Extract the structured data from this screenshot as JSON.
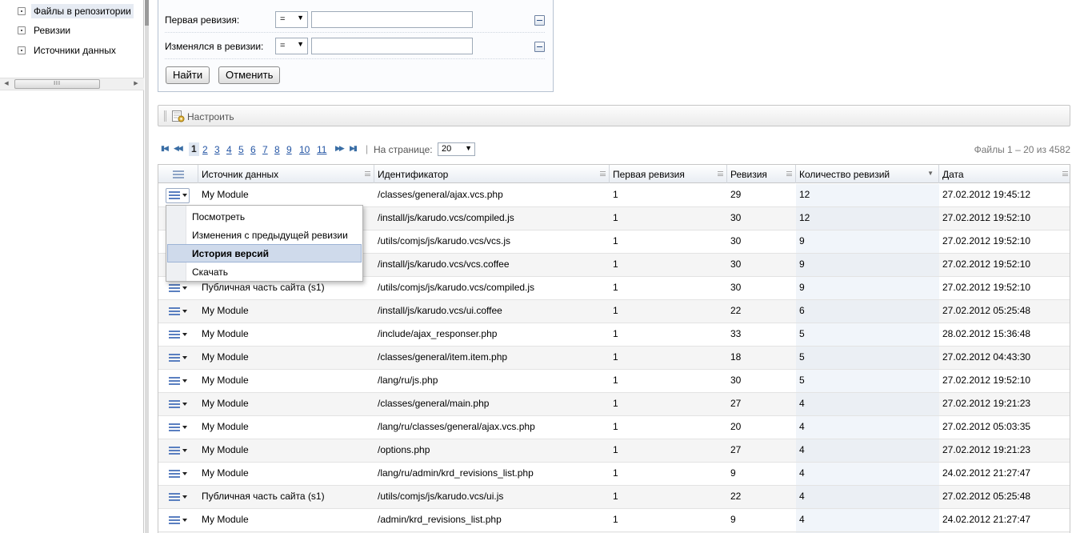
{
  "tree": {
    "items": [
      {
        "label": "Файлы в репозитории",
        "selected": true
      },
      {
        "label": "Ревизии",
        "selected": false
      },
      {
        "label": "Источники данных",
        "selected": false
      }
    ]
  },
  "left_scrollbar": {
    "thumb_glyph": "III"
  },
  "filter": {
    "rows": [
      {
        "label": "Первая ревизия:",
        "operator": "=",
        "value": ""
      },
      {
        "label": "Изменялся в ревизии:",
        "operator": "=",
        "value": ""
      }
    ],
    "find_label": "Найти",
    "cancel_label": "Отменить"
  },
  "toolbar": {
    "settings_label": "Настроить"
  },
  "pager": {
    "pages": [
      "1",
      "2",
      "3",
      "4",
      "5",
      "6",
      "7",
      "8",
      "9",
      "10",
      "11"
    ],
    "current_page": "1",
    "separator": "|",
    "per_page_label": "На странице:",
    "per_page_value": "20",
    "summary": "Файлы 1 – 20 из 4582"
  },
  "grid": {
    "columns": [
      {
        "label": ""
      },
      {
        "label": "Источник данных"
      },
      {
        "label": "Идентификатор"
      },
      {
        "label": "Первая ревизия"
      },
      {
        "label": "Ревизия"
      },
      {
        "label": "Количество ревизий",
        "sorted": "desc"
      },
      {
        "label": "Дата"
      }
    ],
    "rows": [
      {
        "source": "My Module",
        "id": "/classes/general/ajax.vcs.php",
        "first": "1",
        "rev": "29",
        "count": "12",
        "date": "27.02.2012 19:45:12"
      },
      {
        "source": "",
        "id": "/install/js/karudo.vcs/compiled.js",
        "first": "1",
        "rev": "30",
        "count": "12",
        "date": "27.02.2012 19:52:10"
      },
      {
        "source": "",
        "id": "/utils/comjs/js/karudo.vcs/vcs.js",
        "first": "1",
        "rev": "30",
        "count": "9",
        "date": "27.02.2012 19:52:10"
      },
      {
        "source": "",
        "id": "/install/js/karudo.vcs/vcs.coffee",
        "first": "1",
        "rev": "30",
        "count": "9",
        "date": "27.02.2012 19:52:10"
      },
      {
        "source": "Публичная часть сайта (s1)",
        "id": "/utils/comjs/js/karudo.vcs/compiled.js",
        "first": "1",
        "rev": "30",
        "count": "9",
        "date": "27.02.2012 19:52:10"
      },
      {
        "source": "My Module",
        "id": "/install/js/karudo.vcs/ui.coffee",
        "first": "1",
        "rev": "22",
        "count": "6",
        "date": "27.02.2012 05:25:48"
      },
      {
        "source": "My Module",
        "id": "/include/ajax_responser.php",
        "first": "1",
        "rev": "33",
        "count": "5",
        "date": "28.02.2012 15:36:48"
      },
      {
        "source": "My Module",
        "id": "/classes/general/item.item.php",
        "first": "1",
        "rev": "18",
        "count": "5",
        "date": "27.02.2012 04:43:30"
      },
      {
        "source": "My Module",
        "id": "/lang/ru/js.php",
        "first": "1",
        "rev": "30",
        "count": "5",
        "date": "27.02.2012 19:52:10"
      },
      {
        "source": "My Module",
        "id": "/classes/general/main.php",
        "first": "1",
        "rev": "27",
        "count": "4",
        "date": "27.02.2012 19:21:23"
      },
      {
        "source": "My Module",
        "id": "/lang/ru/classes/general/ajax.vcs.php",
        "first": "1",
        "rev": "20",
        "count": "4",
        "date": "27.02.2012 05:03:35"
      },
      {
        "source": "My Module",
        "id": "/options.php",
        "first": "1",
        "rev": "27",
        "count": "4",
        "date": "27.02.2012 19:21:23"
      },
      {
        "source": "My Module",
        "id": "/lang/ru/admin/krd_revisions_list.php",
        "first": "1",
        "rev": "9",
        "count": "4",
        "date": "24.02.2012 21:27:47"
      },
      {
        "source": "Публичная часть сайта (s1)",
        "id": "/utils/comjs/js/karudo.vcs/ui.js",
        "first": "1",
        "rev": "22",
        "count": "4",
        "date": "27.02.2012 05:25:48"
      },
      {
        "source": "My Module",
        "id": "/admin/krd_revisions_list.php",
        "first": "1",
        "rev": "9",
        "count": "4",
        "date": "24.02.2012 21:27:47"
      },
      {
        "source": "",
        "id": "",
        "first": "",
        "rev": "",
        "count": "",
        "date": ""
      }
    ]
  },
  "context_menu": {
    "items": [
      {
        "label": "Посмотреть",
        "active": false
      },
      {
        "label": "Изменения с предыдущей ревизии",
        "active": false
      },
      {
        "label": "История версий",
        "active": true
      },
      {
        "label": "Скачать",
        "active": false
      }
    ]
  },
  "icons": {
    "tree_expander": "plus-box-icon",
    "settings": "settings-icon",
    "row_action": "row-menu-icon",
    "filter_remove": "minus-icon"
  },
  "colors": {
    "accent": "#2455a4",
    "selected_menu_item": "#cfdaeb",
    "row_alt": "#f5f5f5"
  }
}
